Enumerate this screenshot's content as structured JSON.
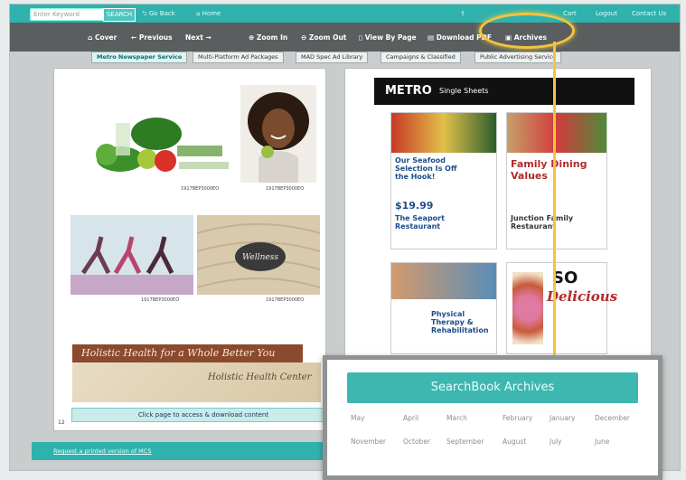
{
  "topbar": {
    "search_placeholder": "Enter Keyword",
    "search_button": "SEARCH",
    "go_back": "Go Back",
    "home": "Home",
    "right_links": [
      "Cart",
      "Logout",
      "Contact Us"
    ]
  },
  "toolbar": {
    "items": [
      "Cover",
      "Previous",
      "Next",
      "Zoom In",
      "Zoom Out",
      "View By Page",
      "Download PDF",
      "Archives"
    ]
  },
  "tabs": [
    "Metro Newspaper Service",
    "Multi-Platform Ad Packages",
    "MAD Spec Ad Library",
    "Campaigns & Classified",
    "Public Advertising Service"
  ],
  "left_page": {
    "codes": [
      "1917BEP3000EO",
      "1917BEP3000EO",
      "1917BEP3000EO",
      "1917BEP3000EO"
    ],
    "wellness_stone": "Wellness",
    "banner": "Holistic Health for a Whole Better You",
    "center_name": "Holistic Health Center",
    "page_num": "12"
  },
  "right_page": {
    "logo": "METRO",
    "header": "Single Sheets",
    "ad_seafood": "Our Seafood Selection Is Off the Hook!",
    "ad_price": "$19.99",
    "ad_seaport": "The Seaport Restaurant",
    "ad_family": "Family Dining Values",
    "ad_junction": "Junction Family Restaurant",
    "ad_physical": "Physical Therapy & Rehabilitation",
    "ad_so": "SO",
    "ad_delicious": "Delicious"
  },
  "access_bar": "Click page to access & download content",
  "footer": {
    "link": "Request a printed version of MCS"
  },
  "archives_popup": {
    "title": "SearchBook Archives",
    "row1": [
      "May",
      "April",
      "March",
      "February",
      "January",
      "December"
    ],
    "row2": [
      "November",
      "October",
      "September",
      "August",
      "July",
      "June"
    ]
  },
  "colors": {
    "teal": "#2fb2ad",
    "toolbar": "#5a5e5f",
    "highlight": "#f4c43c"
  }
}
